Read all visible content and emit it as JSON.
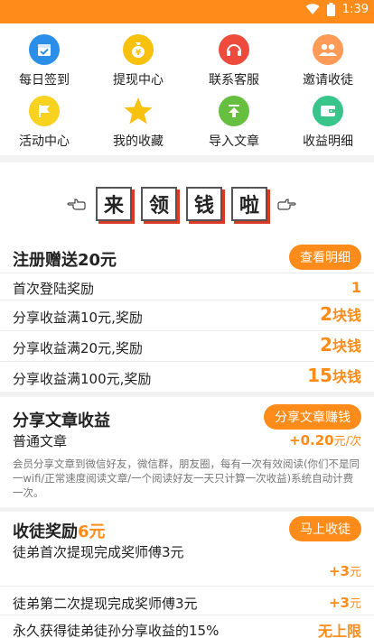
{
  "status": {
    "time": "1:39"
  },
  "quick_actions": [
    {
      "label": "每日签到",
      "icon": "calendar-icon",
      "color": "#2b8ee8"
    },
    {
      "label": "提现中心",
      "icon": "money-bag-icon",
      "color": "#f7c10d"
    },
    {
      "label": "联系客服",
      "icon": "headset-icon",
      "color": "#ee4b3c"
    },
    {
      "label": "邀请收徒",
      "icon": "people-icon",
      "color": "#ff9a57"
    },
    {
      "label": "活动中心",
      "icon": "flag-icon",
      "color": "#f7d21e"
    },
    {
      "label": "我的收藏",
      "icon": "star-icon",
      "color": "#f7c10d"
    },
    {
      "label": "导入文章",
      "icon": "upload-icon",
      "color": "#67bf3f"
    },
    {
      "label": "收益明细",
      "icon": "wallet-icon",
      "color": "#37c58b"
    }
  ],
  "banner": {
    "chars": [
      "来",
      "领",
      "钱",
      "啦"
    ]
  },
  "signup": {
    "title": "注册赠送20元",
    "button": "查看明细",
    "rows": [
      {
        "label": "首次登陆奖励",
        "value": "1",
        "unit": ""
      },
      {
        "label": "分享收益满10元,奖励",
        "value": "2",
        "unit": "块钱"
      },
      {
        "label": "分享收益满20元,奖励",
        "value": "2",
        "unit": "块钱"
      },
      {
        "label": "分享收益满100元,奖励",
        "value": "15",
        "unit": "块钱"
      }
    ]
  },
  "share": {
    "title": "分享文章收益",
    "button": "分享文章赚钱",
    "row_label": "普通文章",
    "row_value": "+0.20",
    "row_unit": "元/次",
    "desc": "会员分享文章到微信好友，微信群，朋友圈，每有一次有效阅读(你们不是同一wifi/正常速度阅读文章/一个阅读好友一天只计算一次收益)系统自动计费一次。"
  },
  "apprentice": {
    "title": "收徒奖励",
    "title_amount": "6元",
    "button": "马上收徒",
    "rows": [
      {
        "label": "徒弟首次提现完成奖师傅3元",
        "value": "+3",
        "unit": "元"
      },
      {
        "label": "徒弟第二次提现完成奖师傅3元",
        "value": "+3",
        "unit": "元"
      },
      {
        "label": "永久获得徒弟徒孙分享收益的15%",
        "value": "无上限",
        "unit": ""
      }
    ]
  },
  "colors": {
    "accent": "#ff8c1a",
    "brand_red": "#d83a28"
  }
}
